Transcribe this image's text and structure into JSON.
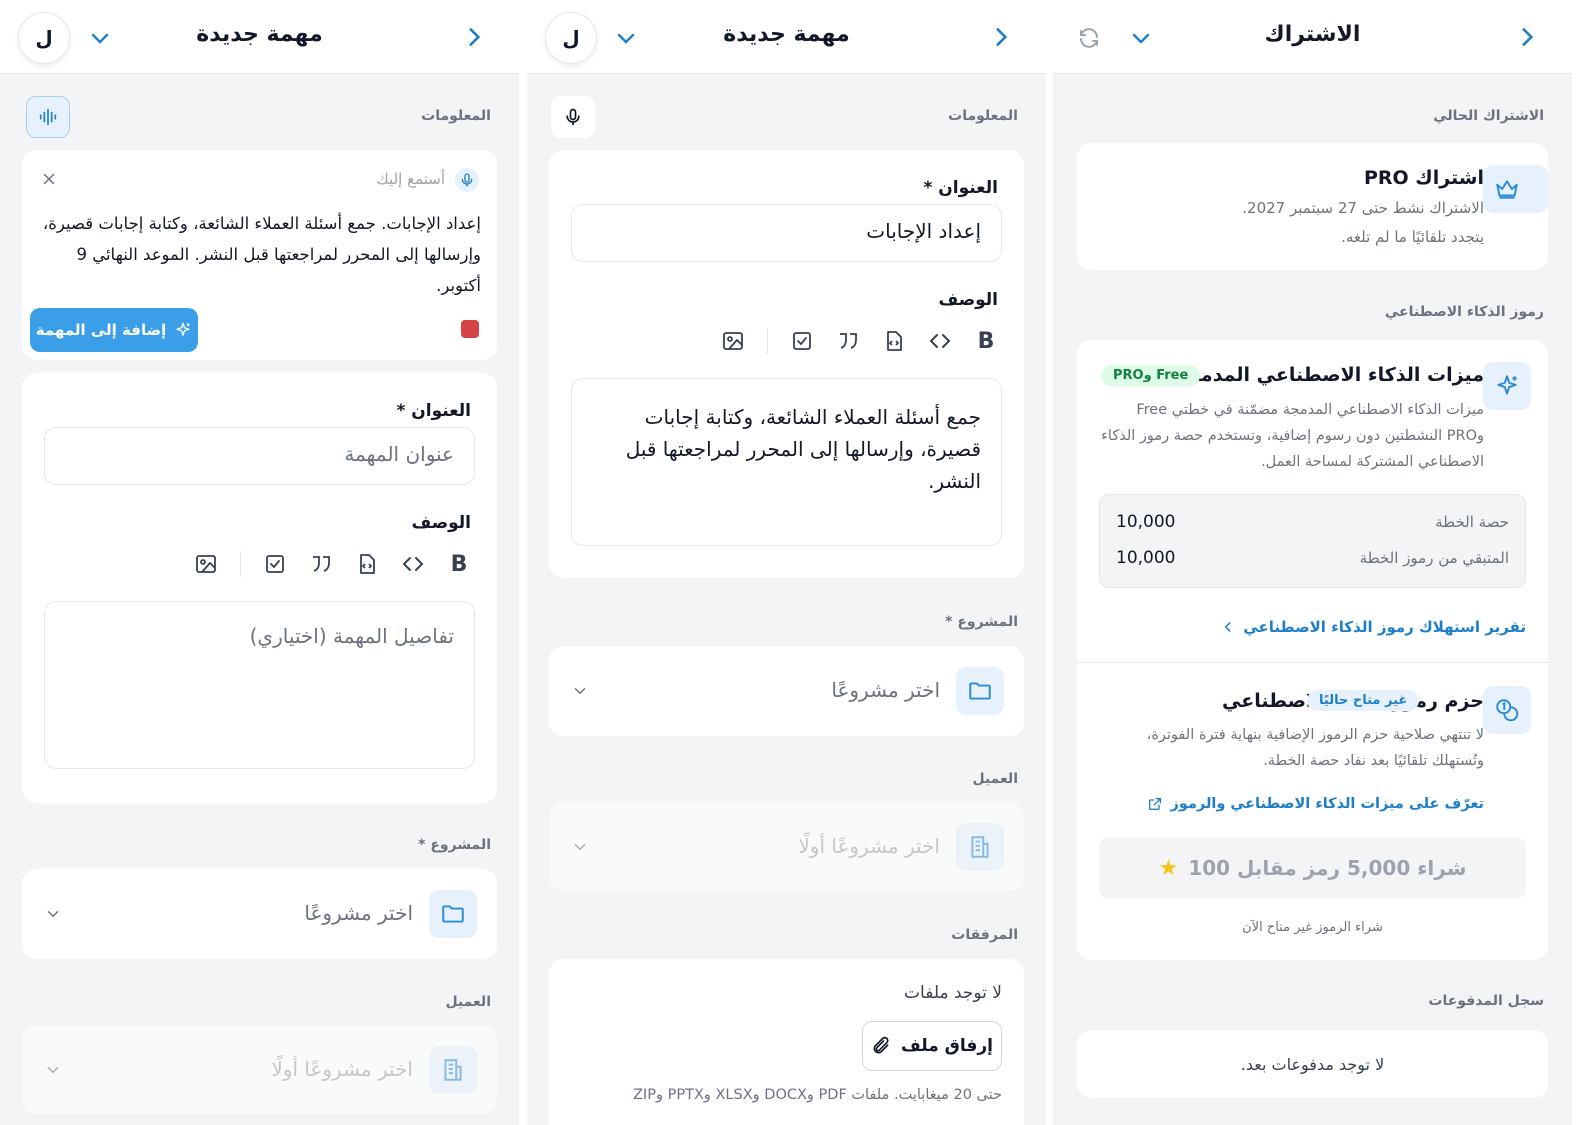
{
  "panel1": {
    "title": "الاشتراك",
    "current_section": "الاشتراك الحالي",
    "pro": {
      "title": "اشتراك PRO",
      "line1": "الاشتراك نشط حتى 27 سبتمبر 2027.",
      "line2": "يتجدد تلقائيًا ما لم تلغه."
    },
    "tokens_section": "رموز الذكاء الاصطناعي",
    "ai": {
      "title": "ميزات الذكاء الاصطناعي المدمجة",
      "badge": "Free وPRO",
      "desc": "ميزات الذكاء الاصطناعي المدمجة مضمّنة في خطتي Free وPRO النشطتين دون رسوم إضافية، وتستخدم حصة رموز الذكاء الاصطناعي المشتركة لمساحة العمل.",
      "rows": [
        {
          "label": "حصة الخطة",
          "value": "10,000"
        },
        {
          "label": "المتبقي من رموز الخطة",
          "value": "10,000"
        }
      ],
      "report_link": "تقرير استهلاك رموز الذكاء الاصطناعي"
    },
    "packs": {
      "title": "حزم رموز الذكاء الاصطناعي",
      "badge": "غير متاح حاليًا",
      "desc": "لا تنتهي صلاحية حزم الرموز الإضافية بنهاية فترة الفوترة، وتُستهلك تلقائيًا بعد نفاد حصة الخطة.",
      "learn_link": "تعرّف على ميزات الذكاء الاصطناعي والرموز",
      "buy_button": "شراء 5,000 رمز مقابل 100",
      "buy_note": "شراء الرموز غير متاح الآن"
    },
    "payments_section": "سجل المدفوعات",
    "payments_empty": "لا توجد مدفوعات بعد."
  },
  "panel2": {
    "title": "مهمة جديدة",
    "avatar": "ل",
    "info_section": "المعلومات",
    "title_label": "العنوان *",
    "title_value": "إعداد الإجابات",
    "desc_label": "الوصف",
    "desc_value": "جمع أسئلة العملاء الشائعة، وكتابة إجابات قصيرة، وإرسالها إلى المحرر لمراجعتها قبل النشر.",
    "project_label": "المشروع *",
    "project_placeholder": "اختر مشروعًا",
    "client_label": "العميل",
    "client_placeholder": "اختر مشروعًا أولًا",
    "attach_section": "المرفقات",
    "no_files": "لا توجد ملفات",
    "attach_button": "إرفاق ملف",
    "attach_note": "حتى 20 ميغابايت. ملفات PDF وDOCX وXLSX وPPTX وZIP"
  },
  "panel3": {
    "title": "مهمة جديدة",
    "avatar": "ل",
    "info_section": "المعلومات",
    "listening": "أستمع إليك",
    "transcript": "إعداد الإجابات. جمع أسئلة العملاء الشائعة، وكتابة إجابات قصيرة، وإرسالها إلى المحرر لمراجعتها قبل النشر. الموعد النهائي 9 أكتوبر.",
    "add_button": "إضافة إلى المهمة",
    "title_label": "العنوان *",
    "title_placeholder": "عنوان المهمة",
    "desc_label": "الوصف",
    "desc_placeholder": "تفاصيل المهمة (اختياري)",
    "project_label": "المشروع *",
    "project_placeholder": "اختر مشروعًا",
    "client_label": "العميل",
    "client_placeholder": "اختر مشروعًا أولًا"
  },
  "colors": {
    "accent": "#1d7fcb",
    "button": "#3b9ee8",
    "stop": "#d64545",
    "green_badge": "#15803d"
  }
}
